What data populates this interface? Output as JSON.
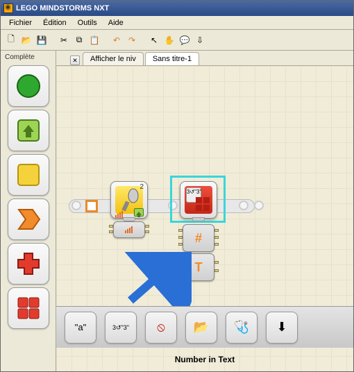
{
  "window": {
    "title": "LEGO MINDSTORMS NXT"
  },
  "menu": {
    "items": [
      "Fichier",
      "Édition",
      "Outils",
      "Aide"
    ]
  },
  "sidebar": {
    "title": "Complète"
  },
  "tabs": {
    "t1": "Afficher le niv",
    "t2": "Sans titre-1"
  },
  "blocks": {
    "sound_badge": "2",
    "num2text_icon": "3↺\"3\"",
    "sub_hash": "#",
    "sub_T": "T"
  },
  "bottom": {
    "a": "\"a\"",
    "b": "3↺\"3\"",
    "c": "⦸",
    "d": "📂",
    "e": "🩺",
    "f": "⬇"
  },
  "caption": "Number in Text"
}
